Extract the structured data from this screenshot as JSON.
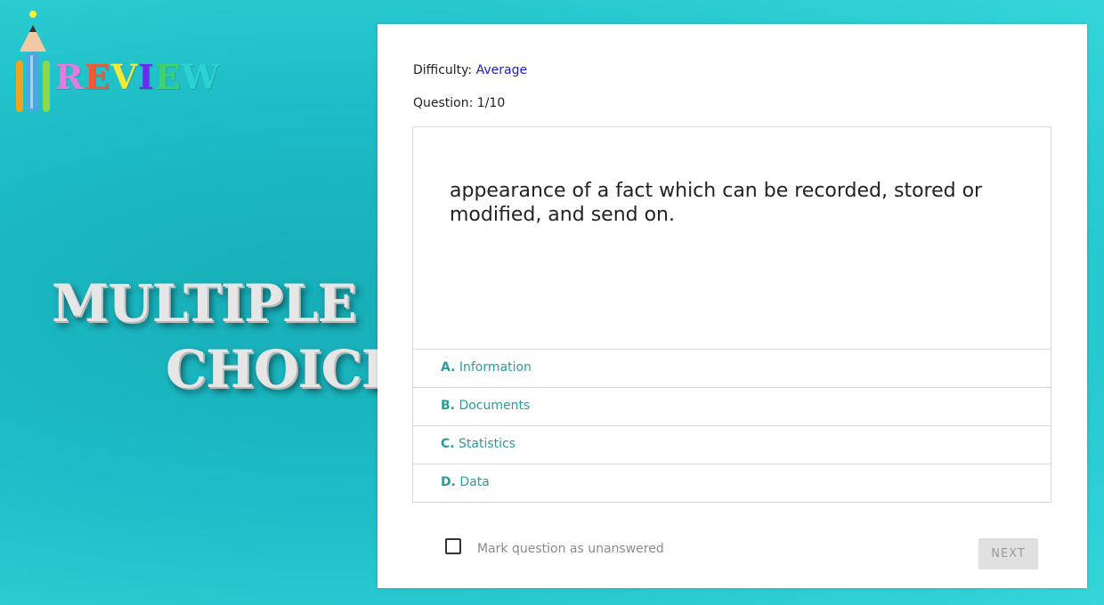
{
  "brand": {
    "logo_letters": [
      {
        "ch": "R",
        "color": "#e47ce0"
      },
      {
        "ch": "E",
        "color": "#ef5a36"
      },
      {
        "ch": "V",
        "color": "#f0e93a"
      },
      {
        "ch": "I",
        "color": "#6a2df0"
      },
      {
        "ch": "E",
        "color": "#3ed26a"
      },
      {
        "ch": "W",
        "color": "#2bd2d2"
      }
    ],
    "icon": "pencil-crayons-icon"
  },
  "banner": {
    "line1": "MULTIPLE",
    "line2": "CHOICE"
  },
  "quiz": {
    "difficulty_label": "Difficulty: ",
    "difficulty_value": "Average",
    "question_label": "Question: 1/10",
    "question_text": "appearance of a fact which can be recorded, stored or modified, and send on.",
    "options": [
      {
        "letter": "A.",
        "text": "Information"
      },
      {
        "letter": "B.",
        "text": "Documents"
      },
      {
        "letter": "C.",
        "text": "Statistics"
      },
      {
        "letter": "D.",
        "text": "Data"
      }
    ],
    "mark_unanswered_label": "Mark question as unanswered",
    "next_label": "NEXT"
  },
  "colors": {
    "accent": "#2e9a9a",
    "difficulty": "#1a1adf",
    "background": "#1dbcc6"
  }
}
